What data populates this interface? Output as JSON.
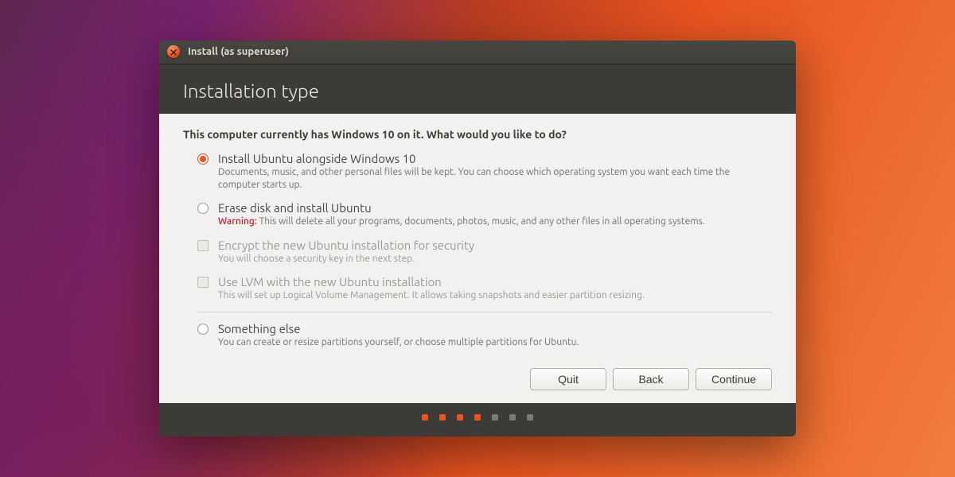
{
  "window": {
    "title": "Install (as superuser)"
  },
  "heading": "Installation type",
  "prompt": "This computer currently has Windows 10 on it. What would you like to do?",
  "options": {
    "alongside": {
      "title": "Install Ubuntu alongside Windows 10",
      "desc": "Documents, music, and other personal files will be kept. You can choose which operating system you want each time the computer starts up."
    },
    "erase": {
      "title": "Erase disk and install Ubuntu",
      "warn_label": "Warning:",
      "desc": "This will delete all your programs, documents, photos, music, and any other files in all operating systems."
    },
    "encrypt": {
      "title": "Encrypt the new Ubuntu installation for security",
      "desc": "You will choose a security key in the next step."
    },
    "lvm": {
      "title": "Use LVM with the new Ubuntu installation",
      "desc": "This will set up Logical Volume Management. It allows taking snapshots and easier partition resizing."
    },
    "something_else": {
      "title": "Something else",
      "desc": "You can create or resize partitions yourself, or choose multiple partitions for Ubuntu."
    }
  },
  "buttons": {
    "quit": "Quit",
    "back": "Back",
    "continue": "Continue"
  },
  "progress": {
    "total": 7,
    "current": 4
  }
}
